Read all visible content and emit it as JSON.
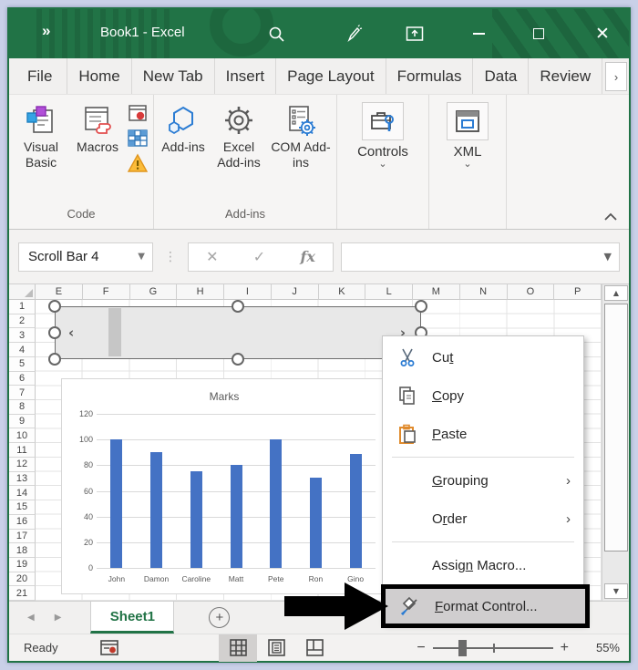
{
  "title_bar": {
    "overflow_glyph": "»",
    "title": "Book1  -  Excel"
  },
  "ribbon_tabs": {
    "tabs": [
      "File",
      "Home",
      "New Tab",
      "Insert",
      "Page Layout",
      "Formulas",
      "Data",
      "Review"
    ],
    "overflow_glyph": "›"
  },
  "ribbon": {
    "code_group": {
      "label": "Code",
      "visual_basic_label": "Visual Basic",
      "macros_label": "Macros"
    },
    "addins_group": {
      "label": "Add-ins",
      "addins_label": "Add-ins",
      "excel_addins_label": "Excel Add-ins",
      "com_addins_label": "COM Add-ins"
    },
    "controls_group": {
      "button_label": "Controls",
      "dropdown_glyph": "⌄"
    },
    "xml_group": {
      "button_label": "XML",
      "dropdown_glyph": "⌄"
    }
  },
  "formula_bar": {
    "name_box_value": "Scroll Bar 4",
    "cancel_glyph": "✕",
    "enter_glyph": "✓",
    "fx_label": "fx"
  },
  "sheet": {
    "columns": [
      "E",
      "F",
      "G",
      "H",
      "I",
      "J",
      "K",
      "L",
      "M",
      "N",
      "O",
      "P"
    ],
    "rows": [
      1,
      2,
      3,
      4,
      5,
      6,
      7,
      8,
      9,
      10,
      11,
      12,
      13,
      14,
      15,
      16,
      17,
      18,
      19,
      20,
      21
    ]
  },
  "scrollbar_control": {
    "left_arrow_glyph": "‹",
    "right_arrow_glyph": "›"
  },
  "chart_data": {
    "type": "bar",
    "title": "Marks",
    "categories": [
      "John",
      "Damon",
      "Caroline",
      "Matt",
      "Pete",
      "Ron",
      "Gino"
    ],
    "values": [
      100,
      90,
      75,
      80,
      100,
      70,
      89
    ],
    "series_color": "#4472C4",
    "ylim": [
      0,
      120
    ],
    "yticks": [
      0,
      20,
      40,
      60,
      80,
      100,
      120
    ],
    "grid": true,
    "legend": false,
    "xlabel": "",
    "ylabel": ""
  },
  "context_menu": {
    "items": [
      {
        "type": "item",
        "name": "cut",
        "icon": "scissors-icon",
        "pre": "Cu",
        "key": "t",
        "post": ""
      },
      {
        "type": "item",
        "name": "copy",
        "icon": "copy-icon",
        "pre": "",
        "key": "C",
        "post": "opy"
      },
      {
        "type": "item",
        "name": "paste",
        "icon": "clipboard-icon",
        "pre": "",
        "key": "P",
        "post": "aste"
      },
      {
        "type": "separator"
      },
      {
        "type": "item",
        "name": "grouping",
        "icon": "",
        "pre": "",
        "key": "G",
        "post": "rouping",
        "submenu": true
      },
      {
        "type": "item",
        "name": "order",
        "icon": "",
        "pre": "O",
        "key": "r",
        "post": "der",
        "submenu": true
      },
      {
        "type": "separator"
      },
      {
        "type": "item",
        "name": "assign-macro",
        "icon": "",
        "pre": "Assig",
        "key": "n",
        "post": " Macro..."
      },
      {
        "type": "item",
        "name": "format-control",
        "icon": "format-control-icon",
        "pre": "",
        "key": "F",
        "post": "ormat Control...",
        "highlighted": true
      }
    ],
    "submenu_glyph": "›"
  },
  "sheet_tab_bar": {
    "active_tab": "Sheet1",
    "add_glyph": "+",
    "prev_glyph": "◀",
    "next_glyph": "▶"
  },
  "status_bar": {
    "mode": "Ready",
    "zoom_percent": "55%"
  },
  "colors": {
    "excel_green": "#217346",
    "bar_blue": "#4472C4",
    "menu_highlight": "#d0cecf"
  }
}
